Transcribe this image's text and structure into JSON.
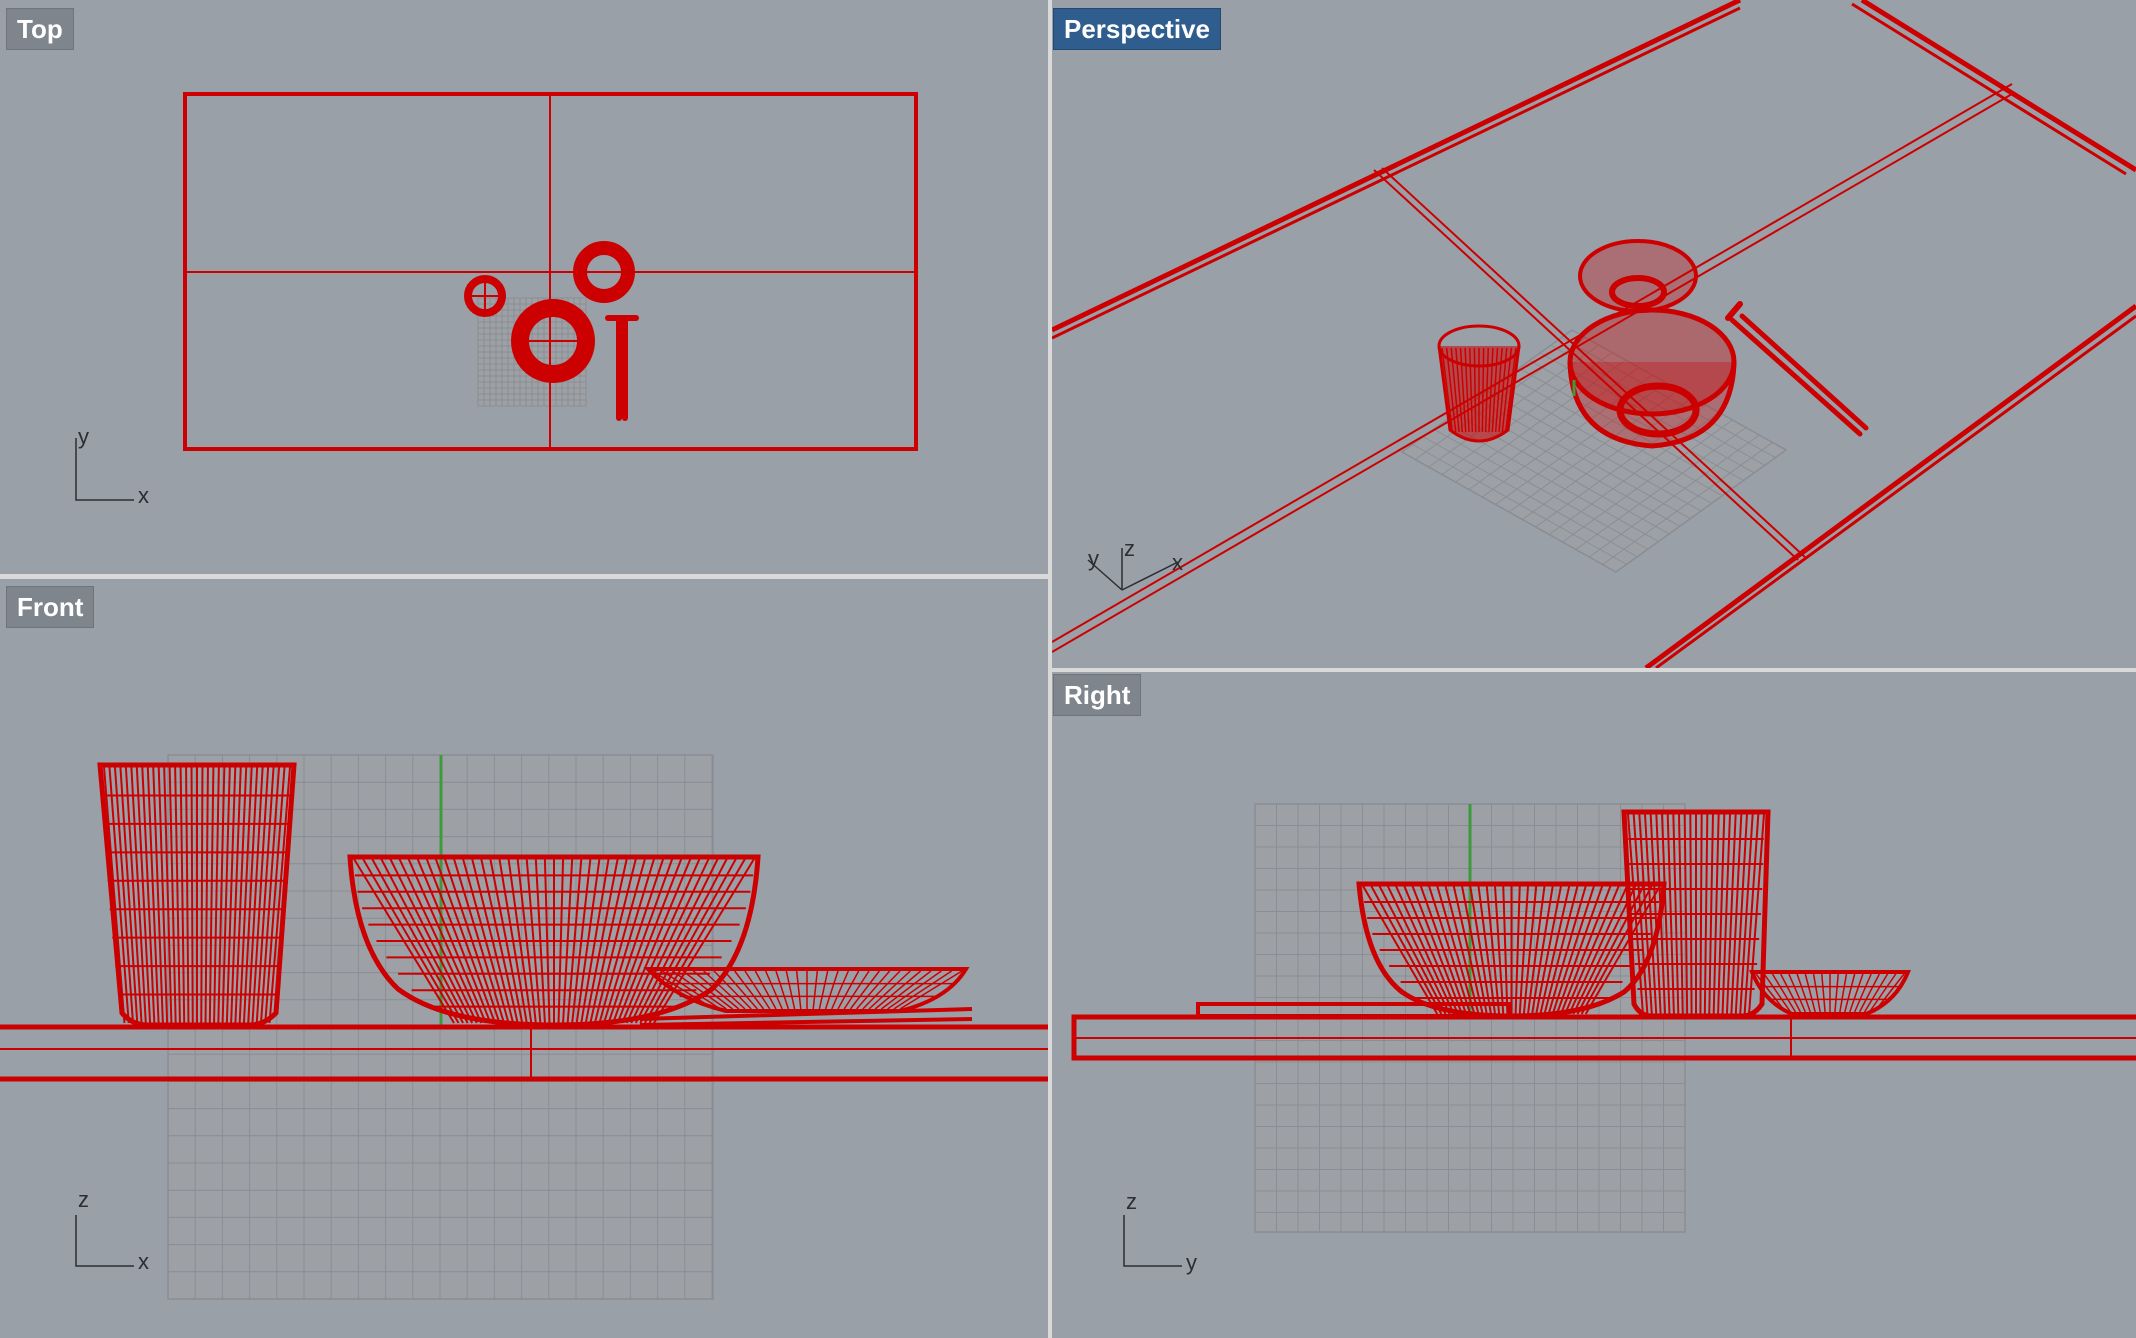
{
  "viewports": {
    "top": {
      "label": "Top",
      "axes": [
        "y",
        "x"
      ]
    },
    "perspective": {
      "label": "Perspective",
      "axes": [
        "y",
        "z",
        "x"
      ],
      "active": true
    },
    "front": {
      "label": "Front",
      "axes": [
        "z",
        "x"
      ]
    },
    "right": {
      "label": "Right",
      "axes": [
        "z",
        "y"
      ]
    }
  },
  "colors": {
    "background": "#9aa0a8",
    "wireframe": "#cc0000",
    "grid": "#8a8e94",
    "z_axis": "#3c9a3c",
    "active_label": "#2e5d8e",
    "label": "#7f858c"
  },
  "icons": {
    "axis_gizmo": "axis-triad-icon"
  }
}
